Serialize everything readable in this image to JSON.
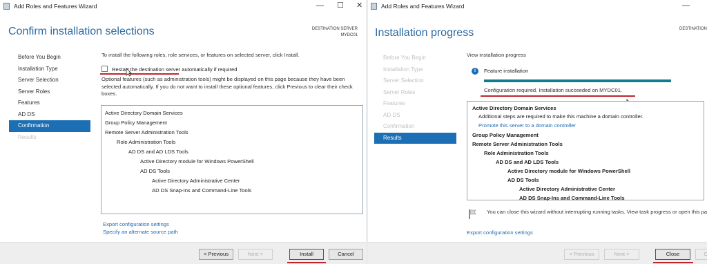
{
  "left_window": {
    "title": "Add Roles and Features Wizard",
    "header": "Confirm installation selections",
    "dest_label": "DESTINATION SERVER",
    "dest_server": "MYDC01",
    "nav": [
      {
        "label": "Before You Begin",
        "state": "normal"
      },
      {
        "label": "Installation Type",
        "state": "normal"
      },
      {
        "label": "Server Selection",
        "state": "normal"
      },
      {
        "label": "Server Roles",
        "state": "normal"
      },
      {
        "label": "Features",
        "state": "normal"
      },
      {
        "label": "AD DS",
        "state": "normal"
      },
      {
        "label": "Confirmation",
        "state": "active"
      },
      {
        "label": "Results",
        "state": "disabled"
      }
    ],
    "intro": "To install the following roles, role services, or features on selected server, click Install.",
    "restart_label": "Restart the destination server automatically if required",
    "restart_checked": false,
    "optional_text": "Optional features (such as administration tools) might be displayed on this page because they have been selected automatically. If you do not want to install these optional features, click Previous to clear their check boxes.",
    "items": [
      "Active Directory Domain Services",
      "Group Policy Management",
      "Remote Server Administration Tools",
      "Role Administration Tools",
      "AD DS and AD LDS Tools",
      "Active Directory module for Windows PowerShell",
      "AD DS Tools",
      "Active Directory Administrative Center",
      "AD DS Snap-Ins and Command-Line Tools"
    ],
    "export_link": "Export configuration settings",
    "alt_source_link": "Specify an alternate source path",
    "buttons": {
      "previous": "< Previous",
      "next": "Next >",
      "install": "Install",
      "cancel": "Cancel"
    }
  },
  "right_window": {
    "title": "Add Roles and Features Wizard",
    "header": "Installation progress",
    "dest_label": "DESTINATION",
    "nav": [
      {
        "label": "Before You Begin",
        "state": "disabled"
      },
      {
        "label": "Installation Type",
        "state": "disabled"
      },
      {
        "label": "Server Selection",
        "state": "disabled"
      },
      {
        "label": "Server Roles",
        "state": "disabled"
      },
      {
        "label": "Features",
        "state": "disabled"
      },
      {
        "label": "AD DS",
        "state": "disabled"
      },
      {
        "label": "Confirmation",
        "state": "disabled"
      },
      {
        "label": "Results",
        "state": "active"
      }
    ],
    "view_label": "View installation progress",
    "feature_install": "Feature installation",
    "progress": 1.0,
    "progress_color": "#117d8e",
    "status": "Configuration required. Installation succeeded on MYDC01.",
    "results": {
      "adds": "Active Directory Domain Services",
      "adds_note": "Additional steps are required to make this machine a domain controller.",
      "promote_link": "Promote this server to a domain controller",
      "items": [
        "Group Policy Management",
        "Remote Server Administration Tools",
        "Role Administration Tools",
        "AD DS and AD LDS Tools",
        "Active Directory module for Windows PowerShell",
        "AD DS Tools",
        "Active Directory Administrative Center",
        "AD DS Snap-Ins and Command-Line Tools"
      ]
    },
    "close_note": "You can close this wizard without interrupting running tasks. View task progress or open this page again by clicking Notifications in the command bar, and then Task Details.",
    "export_link": "Export configuration settings",
    "buttons": {
      "previous": "< Previous",
      "next": "Next >",
      "close": "Close",
      "cancel": "C"
    }
  },
  "colors": {
    "header": "#2c6aa3",
    "nav_active": "#1c6fb4",
    "link": "#1e6ab2",
    "annotation": "#c0262d"
  }
}
